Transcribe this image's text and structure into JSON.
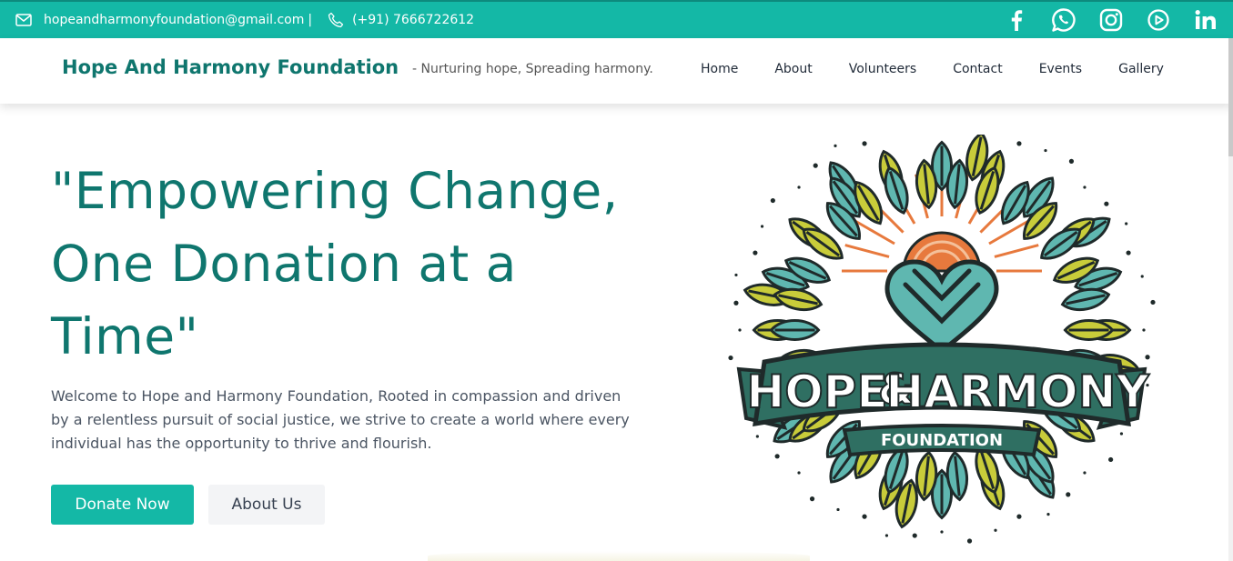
{
  "topbar": {
    "email": "hopeandharmonyfoundation@gmail.com",
    "separator": "|",
    "phone": "(+91) 7666722612",
    "social_icons": [
      "facebook-icon",
      "whatsapp-icon",
      "instagram-icon",
      "youtube-icon",
      "linkedin-icon"
    ]
  },
  "navbar": {
    "brand": "Hope And Harmony Foundation",
    "tagline": "- Nurturing hope, Spreading harmony.",
    "links": [
      "Home",
      "About",
      "Volunteers",
      "Contact",
      "Events",
      "Gallery"
    ]
  },
  "hero": {
    "title": "\"Empowering Change, One Donation at a Time\"",
    "description": "Welcome to Hope and Harmony Foundation, Rooted in compassion and driven by a relentless pursuit of social justice, we strive to create a world where every individual has the opportunity to thrive and flourish.",
    "donate_label": "Donate Now",
    "about_label": "About Us",
    "logo": {
      "name_left": "HOPE",
      "ampersand": "&",
      "name_right": "HARMONY",
      "sub": "FOUNDATION"
    }
  },
  "colors": {
    "accent": "#14b8a6",
    "brand": "#0f766e",
    "leaf_yellow": "#c8cc3a",
    "leaf_teal": "#5fb7b0",
    "sun_orange": "#e7793d"
  }
}
